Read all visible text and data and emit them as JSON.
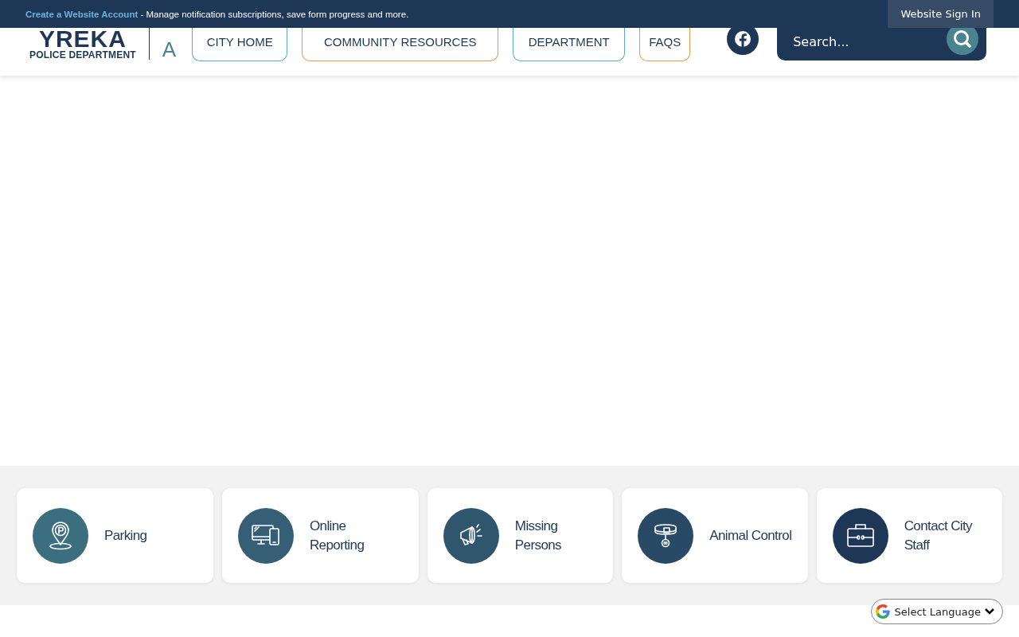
{
  "top_bar": {
    "link": "Create a Website Account",
    "message": " - Manage notification subscriptions, save form progress and more.",
    "sign_in": "Website Sign In"
  },
  "logo": {
    "name": "YREKA",
    "subtitle": "POLICE DEPARTMENT",
    "letters": [
      "A"
    ]
  },
  "nav": [
    {
      "label": "CITY HOME",
      "color": "#5aa9c4"
    },
    {
      "label": "COMMUNITY RESOURCES",
      "color": "#e8974a"
    },
    {
      "label": "DEPARTMENT",
      "color": "#5aa9c4"
    },
    {
      "label": "FAQS",
      "color": "#e8974a"
    }
  ],
  "search": {
    "placeholder": "Search..."
  },
  "quick_links": [
    {
      "label": "Parking",
      "kind": "parking",
      "color": "#3b6e7f"
    },
    {
      "label": "Online Reporting",
      "kind": "devices",
      "color": "#365f75"
    },
    {
      "label": "Missing Persons",
      "kind": "megaphone",
      "color": "#30566e"
    },
    {
      "label": "Animal Control",
      "kind": "collar",
      "color": "#284a66"
    },
    {
      "label": "Contact City Staff",
      "kind": "briefcase",
      "color": "#1f3756"
    }
  ],
  "language": {
    "label": "Select Language"
  }
}
